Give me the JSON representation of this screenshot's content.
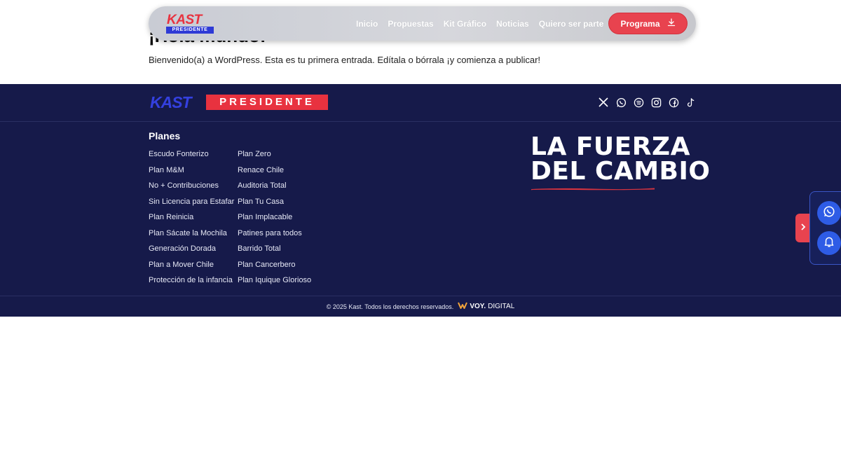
{
  "post": {
    "title": "¡Hola mundo!",
    "text": "Bienvenido(a) a WordPress. Esta es tu primera entrada. Edítala o bórrala ¡y comienza a publicar!"
  },
  "header": {
    "logo_kast": "KAST",
    "logo_presidente": "PRESIDENTE",
    "nav": [
      "Inicio",
      "Propuestas",
      "Kit Gráfico",
      "Noticias",
      "Quiero ser parte"
    ],
    "program_button": "Programa"
  },
  "footer": {
    "logo_kast": "KAST",
    "logo_presidente": "PRESIDENTE",
    "socials": [
      "x-icon",
      "whatsapp-icon",
      "spotify-icon",
      "instagram-icon",
      "facebook-icon",
      "tiktok-icon"
    ],
    "planes_title": "Planes",
    "planes_col1": [
      "Escudo Fonterizo",
      "Plan M&M",
      "No + Contribuciones",
      "Sin Licencia para Estafar",
      "Plan Reinicia",
      "Plan Sácate la Mochila",
      "Generación Dorada",
      "Plan a Mover Chile",
      "Protección de la infancia"
    ],
    "planes_col2": [
      "Plan Zero",
      "Renace Chile",
      "Auditoria Total",
      "Plan Tu Casa",
      "Plan Implacable",
      "Patines para todos",
      "Barrido Total",
      "Plan Cancerbero",
      "Plan Iquique Glorioso"
    ],
    "slogan_line1": "LA FUERZA",
    "slogan_line2": "DEL CAMBIO",
    "copyright": "© 2025 Kast. Todos los derechos reservados.",
    "credit_brand": "VOY.",
    "credit_suffix": "DIGITAL"
  },
  "colors": {
    "footer_bg": "#161a4a",
    "accent_red": "#e8434f",
    "brand_blue": "#3440e0"
  }
}
